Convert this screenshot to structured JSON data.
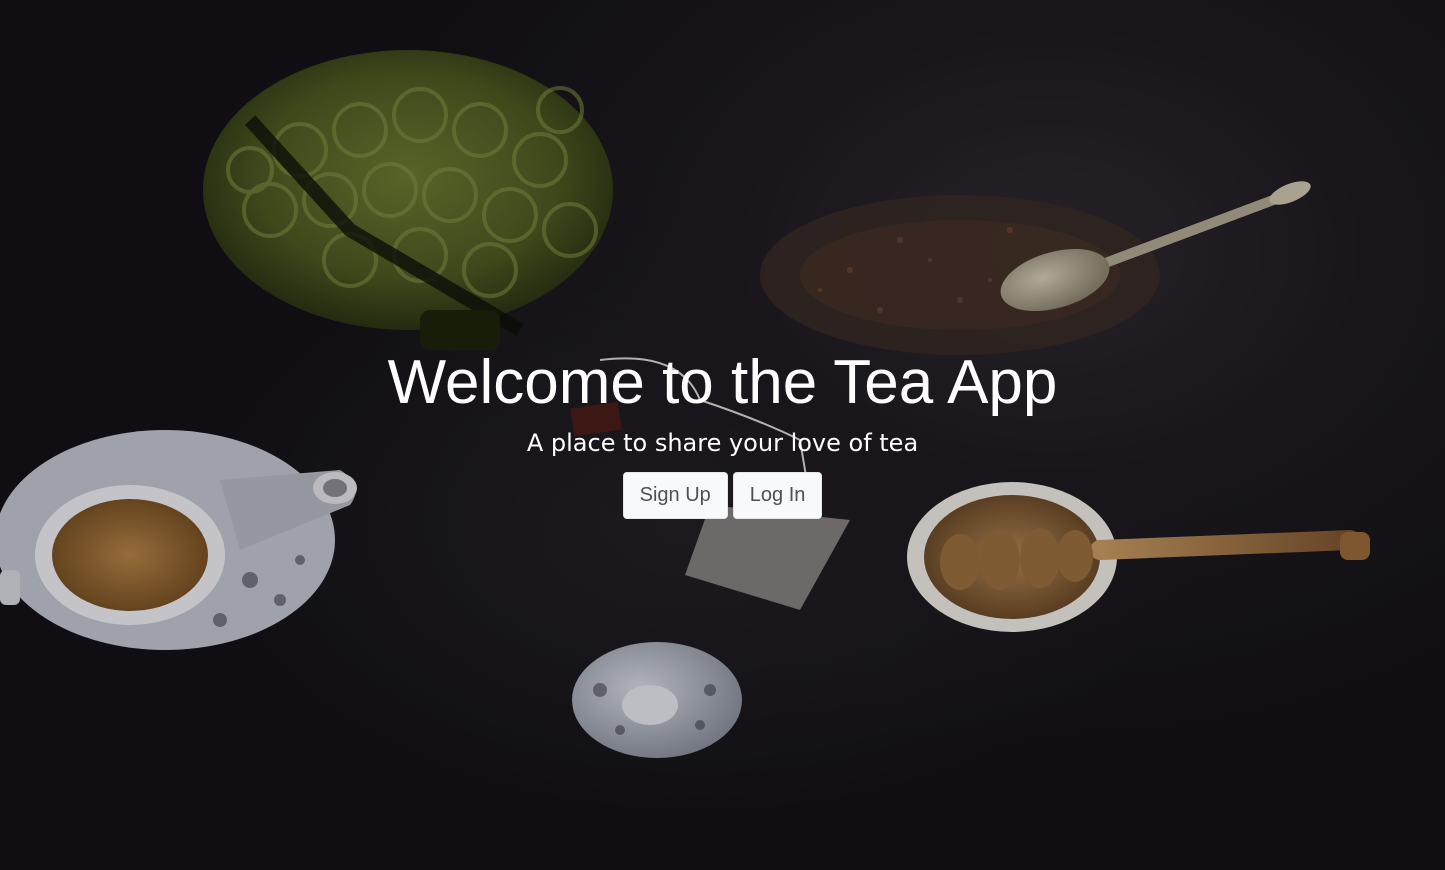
{
  "hero": {
    "title": "Welcome to the Tea App",
    "subtitle": "A place to share your love of tea",
    "background": "dark tea still life photo"
  },
  "actions": {
    "signup_label": "Sign Up",
    "login_label": "Log In"
  },
  "colors": {
    "background": "#141216",
    "text": "#ffffff",
    "button_bg": "#f8f9fa",
    "button_text": "#505050"
  }
}
